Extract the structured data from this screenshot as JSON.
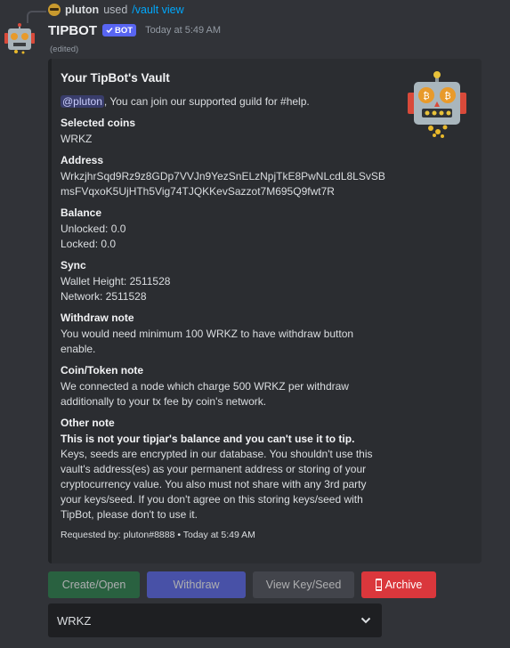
{
  "reply": {
    "user": "pluton",
    "used_text": "used",
    "command": "/vault view"
  },
  "header": {
    "username": "TIPBOT",
    "bot_badge": "BOT",
    "timestamp": "Today at 5:49 AM",
    "edited": "(edited)"
  },
  "embed": {
    "title": "Your TipBot's Vault",
    "mention": "@pluton",
    "mention_suffix": ", You can join our supported guild for #help.",
    "fields": [
      {
        "name": "Selected coins",
        "lines": [
          "WRKZ"
        ]
      },
      {
        "name": "Address",
        "lines": [
          "WrkzjhrSqd9Rz9z8GDp7VVJn9YezSnELzNpjTkE8PwNLcdL8LSvSB",
          "msFVqxoK5UjHTh5Vig74TJQKKevSazzot7M695Q9fwt7R"
        ]
      },
      {
        "name": "Balance",
        "lines": [
          "Unlocked: 0.0",
          "Locked: 0.0"
        ]
      },
      {
        "name": "Sync",
        "lines": [
          "Wallet Height: 2511528",
          "Network: 2511528"
        ]
      },
      {
        "name": "Withdraw note",
        "lines": [
          "You would need minimum 100 WRKZ to have withdraw button",
          "enable."
        ]
      },
      {
        "name": "Coin/Token note",
        "lines": [
          "We connected a node which charge 500 WRKZ per withdraw",
          "additionally to your tx fee by coin's network."
        ]
      }
    ],
    "other_note": {
      "name": "Other note",
      "bold_line": "This is not your tipjar's balance and you can't use it to tip.",
      "lines": [
        "Keys, seeds are encrypted in our database. You shouldn't use this",
        "vault's address(es) as your permanent address or storing of your",
        "cryptocurrency value. You also must not share with any 3rd party",
        "your keys/seed. If you don't agree on this storing keys/seed with",
        "TipBot, please don't to use it."
      ]
    },
    "footer": "Requested by: pluton#8888 • Today at 5:49 AM"
  },
  "buttons": {
    "create": "Create/Open",
    "withdraw": "Withdraw",
    "view_key": "View Key/Seed",
    "archive": "Archive"
  },
  "select": {
    "value": "WRKZ"
  },
  "colors": {
    "background": "#313338",
    "embed": "#2b2d31",
    "blurple": "#5865f2",
    "green": "#248046",
    "red": "#da373c",
    "link": "#00a8fc"
  }
}
